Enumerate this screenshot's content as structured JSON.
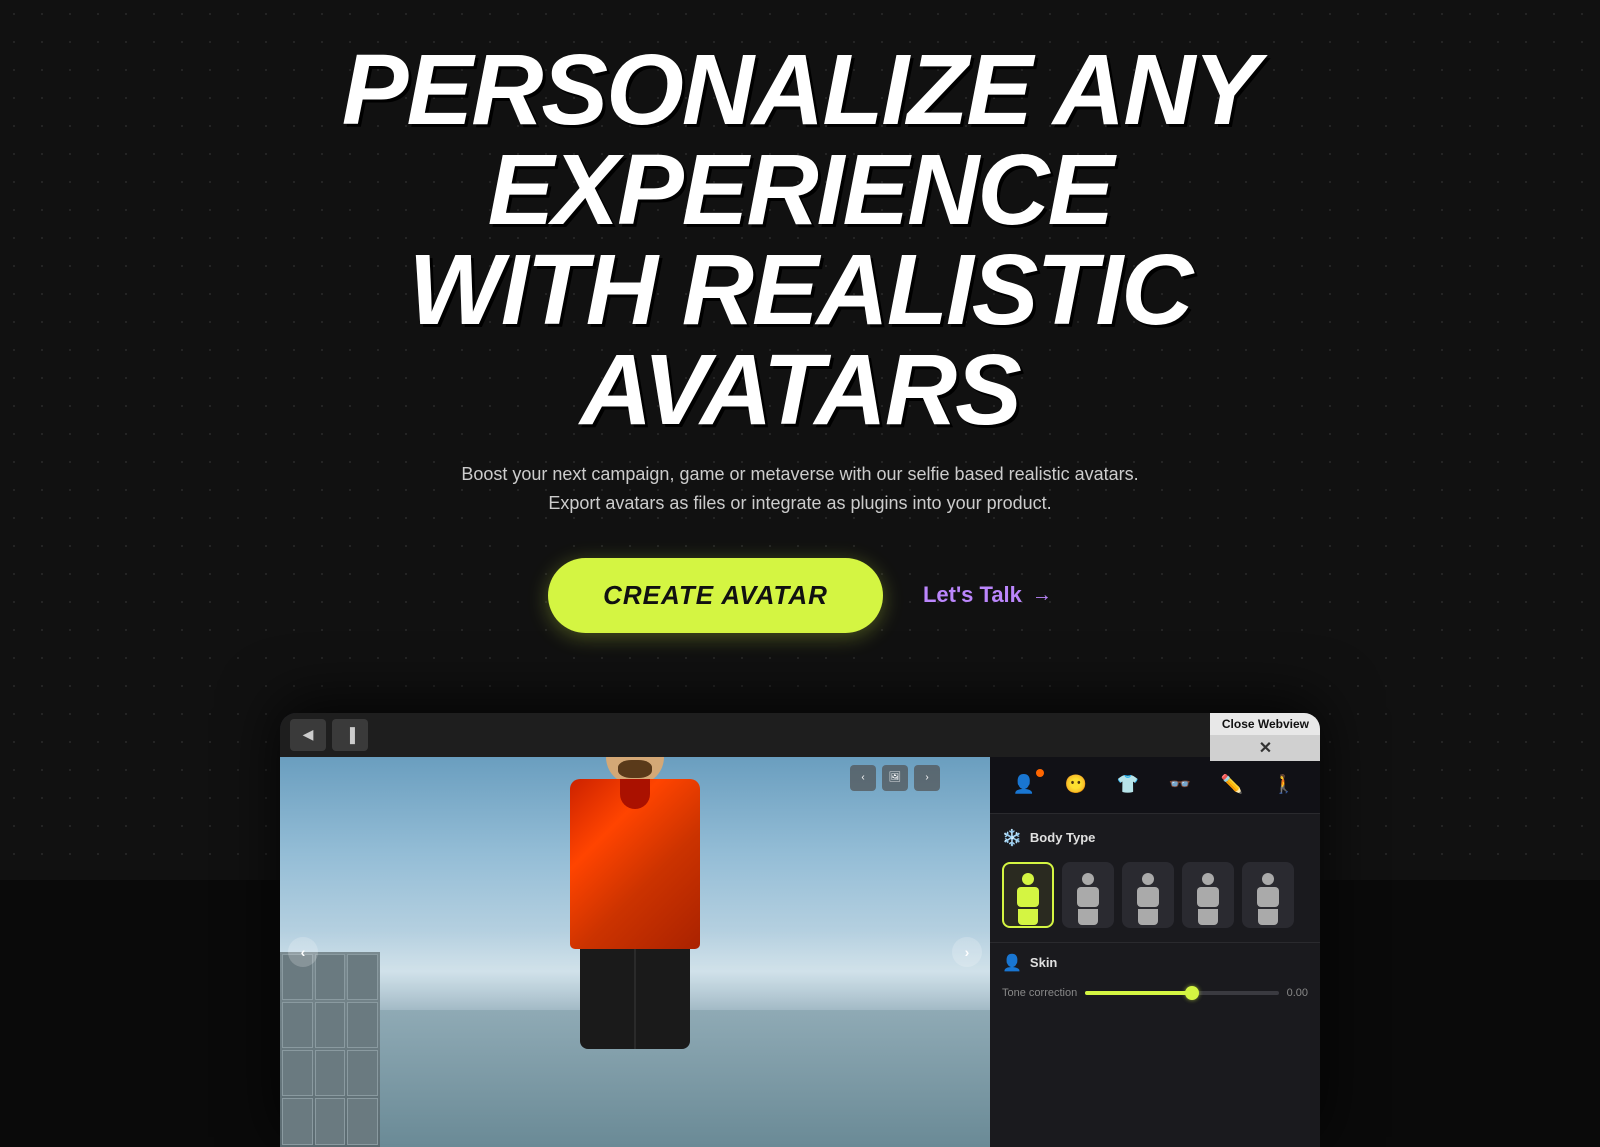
{
  "hero": {
    "title_line1": "PERSONALIZE ANY EXPERIENCE",
    "title_line2": "WITH REALISTIC AVATARS",
    "subtitle": "Boost your next campaign, game or metaverse with our selfie based realistic avatars. Export avatars as files or integrate as plugins into your product.",
    "cta_primary": "CREATE AVATAR",
    "cta_secondary": "Let's Talk",
    "cta_arrow": "→"
  },
  "preview": {
    "close_webview_label": "Close Webview",
    "close_x": "✕",
    "nav_left": "‹",
    "nav_right": "›",
    "topbar_btn1": "◀",
    "topbar_btn2": "▐"
  },
  "customization_panel": {
    "tabs": [
      {
        "icon": "👤",
        "label": "body",
        "active": true,
        "badge": true
      },
      {
        "icon": "😶",
        "label": "face",
        "active": false,
        "badge": false
      },
      {
        "icon": "👕",
        "label": "clothing",
        "active": false,
        "badge": false
      },
      {
        "icon": "👓",
        "label": "accessories",
        "active": false,
        "badge": false
      },
      {
        "icon": "✏️",
        "label": "edit",
        "active": false,
        "badge": false
      },
      {
        "icon": "🚶",
        "label": "pose",
        "active": false,
        "badge": false
      }
    ],
    "body_type_section": {
      "label": "Body Type",
      "options": [
        {
          "id": "1",
          "selected": true
        },
        {
          "id": "2",
          "selected": false
        },
        {
          "id": "3",
          "selected": false
        },
        {
          "id": "4",
          "selected": false
        },
        {
          "id": "5",
          "selected": false
        }
      ]
    },
    "skin_section": {
      "label": "Skin",
      "tone_label": "Tone correction",
      "tone_value": "0.00",
      "tone_percent": 55
    }
  },
  "colors": {
    "accent_green": "#d4f542",
    "accent_purple": "#bb86fc",
    "bg_dark": "#111111",
    "panel_bg": "#1a1a1e"
  }
}
